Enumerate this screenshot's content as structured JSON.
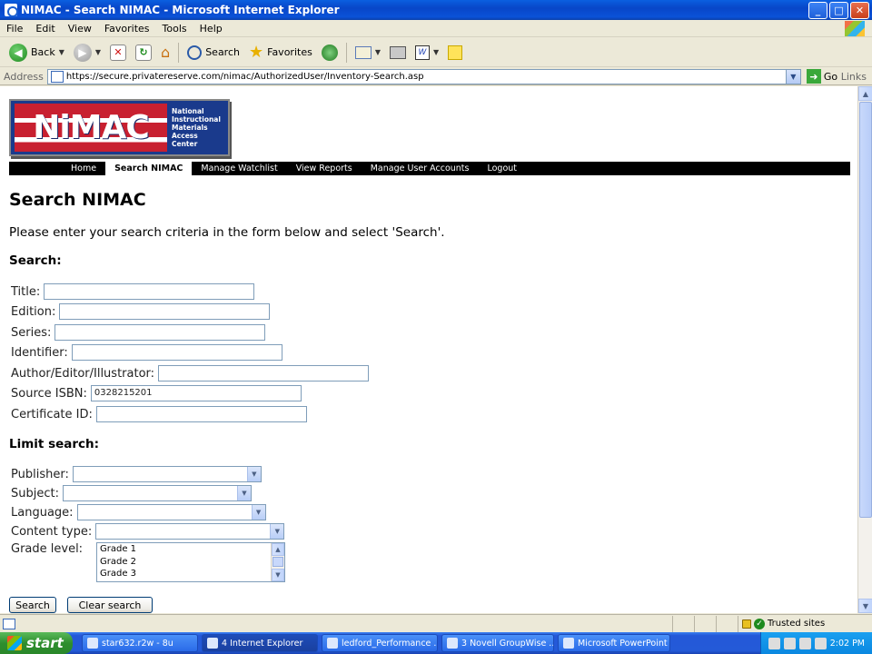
{
  "window": {
    "title": "NIMAC - Search NIMAC - Microsoft Internet Explorer",
    "buttons": {
      "minimize": "_",
      "maximize": "□",
      "close": "✕"
    }
  },
  "menubar": {
    "items": [
      "File",
      "Edit",
      "View",
      "Favorites",
      "Tools",
      "Help"
    ]
  },
  "toolbar": {
    "back_label": "Back",
    "search_label": "Search",
    "favorites_label": "Favorites"
  },
  "addressbar": {
    "label": "Address",
    "url": "https://secure.privatereserve.com/nimac/AuthorizedUser/Inventory-Search.asp",
    "go_label": "Go",
    "links_label": "Links"
  },
  "logo": {
    "wordmark": "NiMAC",
    "tagline_lines": [
      "National",
      "Instructional",
      "Materials",
      "Access",
      "Center"
    ]
  },
  "nav": {
    "items": [
      {
        "label": "Home",
        "active": false
      },
      {
        "label": "Search NIMAC",
        "active": true
      },
      {
        "label": "Manage Watchlist",
        "active": false
      },
      {
        "label": "View Reports",
        "active": false
      },
      {
        "label": "Manage User Accounts",
        "active": false
      },
      {
        "label": "Logout",
        "active": false
      }
    ]
  },
  "page": {
    "title": "Search NIMAC",
    "intro": "Please enter your search criteria in the form below and select 'Search'.",
    "search_heading": "Search:",
    "limit_heading": "Limit search:"
  },
  "search_fields": [
    {
      "label": "Title:",
      "value": ""
    },
    {
      "label": "Edition:",
      "value": ""
    },
    {
      "label": "Series:",
      "value": ""
    },
    {
      "label": "Identifier:",
      "value": ""
    },
    {
      "label": "Author/Editor/Illustrator:",
      "value": ""
    },
    {
      "label": "Source ISBN:",
      "value": "0328215201"
    },
    {
      "label": "Certificate ID:",
      "value": ""
    }
  ],
  "limit_fields": [
    {
      "label": "Publisher:",
      "value": ""
    },
    {
      "label": "Subject:",
      "value": ""
    },
    {
      "label": "Language:",
      "value": ""
    },
    {
      "label": "Content type:",
      "value": ""
    }
  ],
  "grade_level": {
    "label": "Grade level:",
    "options": [
      "Grade 1",
      "Grade 2",
      "Grade 3"
    ]
  },
  "buttons": {
    "search": "Search",
    "clear": "Clear search"
  },
  "statusbar": {
    "zone": "Trusted sites"
  },
  "taskbar": {
    "start": "start",
    "tasks": [
      {
        "label": "star632.r2w - 8u",
        "active": false
      },
      {
        "label": "4 Internet Explorer",
        "active": true
      },
      {
        "label": "ledford_Performance ...",
        "active": false
      },
      {
        "label": "3 Novell GroupWise ...",
        "active": false
      },
      {
        "label": "Microsoft PowerPoint ...",
        "active": false
      }
    ],
    "clock": "2:02 PM"
  },
  "colors": {
    "nav_bg": "#000000",
    "logo_red": "#c82030",
    "logo_blue": "#1a3a8c",
    "titlebar": "#0846c8"
  }
}
